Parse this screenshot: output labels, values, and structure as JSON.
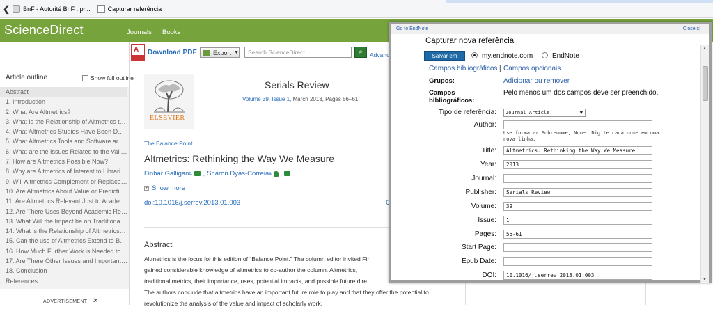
{
  "browser": {
    "bookmarks": [
      {
        "label": "BnF - Autorité BnF : pr..."
      },
      {
        "label": "Capturar referência"
      }
    ]
  },
  "header": {
    "logo": "ScienceDirect",
    "nav": [
      "Journals",
      "Books"
    ]
  },
  "outline": {
    "title": "Article outline",
    "show_full_label": "Show full outline",
    "items": [
      "Abstract",
      "1. Introduction",
      "2. What Are Altmetrics?",
      "3. What is the Relationship of Altmetrics to Bibliometrics?",
      "4. What Altmetrics Studies Have Been Done?",
      "5. What Altmetrics Tools and Software are Available?",
      "6. What are the Issues Related to the Validity of Altmetrics?",
      "7. How are Altmetrics Possible Now?",
      "8. Why are Altmetrics of Interest to Librarians?",
      "9. Will Altmetrics Complement or Replace Traditional Metrics?",
      "10. Are Altmetrics About Value or Prediction?",
      "11. Are Altmetrics Relevant Just to Academic Libraries?",
      "12. Are There Uses Beyond Academic Research?",
      "13. What Will the Impact be on Traditional Publishing?",
      "14. What is the Relationship of Altmetrics to Open Access?",
      "15. Can the use of Altmetrics Extend to Books?",
      "16. How Much Further Work is Needed to Validate Altmetrics?",
      "17. Are There Other Issues and Important Questions?",
      "18. Conclusion",
      "References"
    ],
    "advertisement": "ADVERTISEMENT",
    "ad_close": "✕"
  },
  "toolbar": {
    "pdf_glyph": "A",
    "download_pdf": "Download PDF",
    "export": "Export",
    "search_placeholder": "Search ScienceDirect",
    "search_glyph": "🔍",
    "advanced": "Advanc"
  },
  "journal": {
    "publisher": "ELSEVIER",
    "name": "Serials Review",
    "volume": "Volume 39, Issue 1",
    "meta_rest": ", March 2013, Pages 56–61"
  },
  "article": {
    "section": "The Balance Point",
    "title": "Altmetrics: Rethinking the Way We Measure",
    "author1": "Finbar Galligan",
    "author1_sup": "b,",
    "author2": "Sharon Dyas-Correia",
    "author2_sup": "a,",
    "show_more": "Show more",
    "doi": "doi:10.1016/j.serrev.2013.01.003",
    "cite_partial": "C",
    "abstract_heading": "Abstract",
    "abstract_lines": [
      "Altmetrics is the focus for this edition of “Balance Point.” The column editor invited Fir",
      "gained considerable knowledge of altmetrics to co-author the column. Altmetrics,",
      "traditional metrics, their importance, uses, potential impacts, and possible future dire",
      "The authors conclude that altmetrics have an important future role to play and that they offer the potential to",
      "revolutionize the analysis of the value and impact of scholarly work."
    ]
  },
  "endnote": {
    "goto": "Go to EndNote",
    "close": "Close[x]",
    "title": "Capturar nova referência",
    "save": "Salvar em",
    "radio_my": "my.endnote.com",
    "radio_en": "EndNote",
    "tab_bib": "Campos bibliográficos",
    "tab_sep": "|",
    "tab_opt": "Campos opcionais",
    "grupos_label": "Grupos:",
    "grupos_link": "Adicionar ou remover",
    "campos_label": "Campos bibliográficos:",
    "campos_text": "Pelo menos um dos campos deve ser preenchido.",
    "tipo_label": "Tipo de referência:",
    "tipo_value": "Journal Article",
    "author_label": "Author:",
    "author_value": "",
    "author_hint": "Use formatar Sobrenome, Nome. Digite cada nome em uma nova linha.",
    "fields": [
      {
        "label": "Title:",
        "value": "Altmetrics: Rethinking the Way We Measure"
      },
      {
        "label": "Year:",
        "value": "2013"
      },
      {
        "label": "Journal:",
        "value": ""
      },
      {
        "label": "Publisher:",
        "value": "Serials Review"
      },
      {
        "label": "Volume:",
        "value": "39"
      },
      {
        "label": "Issue:",
        "value": "1"
      },
      {
        "label": "Pages:",
        "value": "56-61"
      },
      {
        "label": "Start Page:",
        "value": ""
      },
      {
        "label": "Epub Date:",
        "value": ""
      },
      {
        "label": "DOI:",
        "value": "10.1016/j.serrev.2013.01.003"
      }
    ]
  }
}
